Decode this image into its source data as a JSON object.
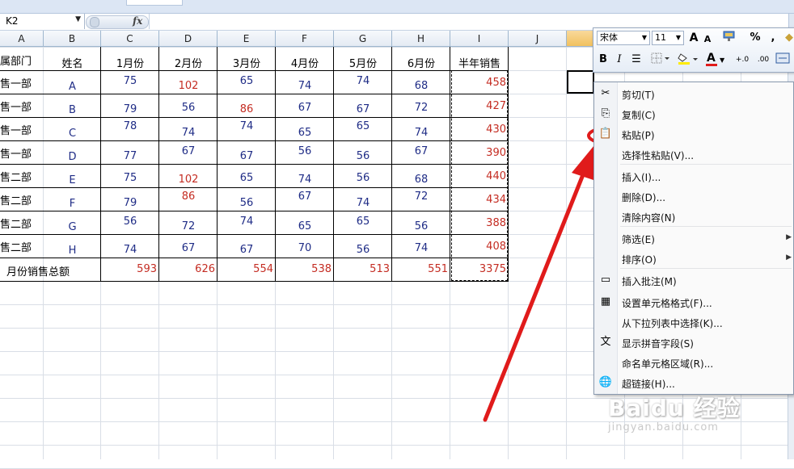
{
  "formula_bar": {
    "name_box": "K2",
    "fx_label": "fx"
  },
  "columns": [
    "A",
    "B",
    "C",
    "D",
    "E",
    "F",
    "G",
    "H",
    "I",
    "J",
    "K"
  ],
  "table": {
    "header": [
      "属部门",
      "姓名",
      "1月份",
      "2月份",
      "3月份",
      "4月份",
      "5月份",
      "6月份",
      "半年销售"
    ],
    "rows": [
      {
        "dept": "售一部",
        "name": "A",
        "values": [
          "75",
          "102",
          "65",
          "74",
          "74",
          "68"
        ],
        "total": "458"
      },
      {
        "dept": "售一部",
        "name": "B",
        "values": [
          "79",
          "56",
          "86",
          "67",
          "67",
          "72"
        ],
        "total": "427"
      },
      {
        "dept": "售一部",
        "name": "C",
        "values": [
          "78",
          "74",
          "74",
          "65",
          "65",
          "74"
        ],
        "total": "430"
      },
      {
        "dept": "售一部",
        "name": "D",
        "values": [
          "77",
          "67",
          "67",
          "56",
          "56",
          "67"
        ],
        "total": "390"
      },
      {
        "dept": "售二部",
        "name": "E",
        "values": [
          "75",
          "102",
          "65",
          "74",
          "56",
          "68"
        ],
        "total": "440"
      },
      {
        "dept": "售二部",
        "name": "F",
        "values": [
          "79",
          "86",
          "56",
          "67",
          "74",
          "72"
        ],
        "total": "434"
      },
      {
        "dept": "售二部",
        "name": "G",
        "values": [
          "56",
          "72",
          "74",
          "65",
          "65",
          "56"
        ],
        "total": "388"
      },
      {
        "dept": "售二部",
        "name": "H",
        "values": [
          "74",
          "67",
          "67",
          "70",
          "56",
          "74"
        ],
        "total": "408"
      }
    ],
    "summary_label": "月份销售总额",
    "summary_values": [
      "593",
      "626",
      "554",
      "538",
      "513",
      "551"
    ],
    "summary_total": "3375",
    "red_cells": [
      [
        0,
        1
      ],
      [
        1,
        2
      ],
      [
        4,
        1
      ],
      [
        5,
        1
      ]
    ]
  },
  "mini_toolbar": {
    "font_name": "宋体",
    "font_size": "11",
    "grow_font": "A",
    "shrink_font": "A",
    "percent": "%",
    "comma": ",",
    "bold": "B",
    "italic": "I",
    "font_color_letter": "A",
    "inc_decimal": "+.0",
    "dec_decimal": ".00"
  },
  "context_menu": {
    "items": [
      {
        "label": "剪切(T)",
        "icon": "✂"
      },
      {
        "label": "复制(C)",
        "icon": "⎘"
      },
      {
        "label": "粘贴(P)",
        "icon": "📋"
      },
      {
        "label": "选择性粘贴(V)...",
        "icon": ""
      },
      {
        "label": "插入(I)...",
        "icon": ""
      },
      {
        "label": "删除(D)...",
        "icon": ""
      },
      {
        "label": "清除内容(N)",
        "icon": ""
      },
      {
        "label": "筛选(E)",
        "icon": "",
        "submenu": true
      },
      {
        "label": "排序(O)",
        "icon": "",
        "submenu": true
      },
      {
        "label": "插入批注(M)",
        "icon": "▭"
      },
      {
        "label": "设置单元格格式(F)...",
        "icon": "▦"
      },
      {
        "label": "从下拉列表中选择(K)...",
        "icon": ""
      },
      {
        "label": "显示拼音字段(S)",
        "icon": "文"
      },
      {
        "label": "命名单元格区域(R)...",
        "icon": ""
      },
      {
        "label": "超链接(H)...",
        "icon": "🌐"
      }
    ],
    "submenu_arrow": "▶"
  },
  "watermark": {
    "brand": "Baidu 经验",
    "url": "jingyan.baidu.com"
  },
  "colors": {
    "value_blue": "#1f2c86",
    "value_red": "#c42c22",
    "annotation_red": "#e01b1b",
    "header_bg": "#e4eaf3",
    "selected_col_header": "#f1c15f"
  }
}
